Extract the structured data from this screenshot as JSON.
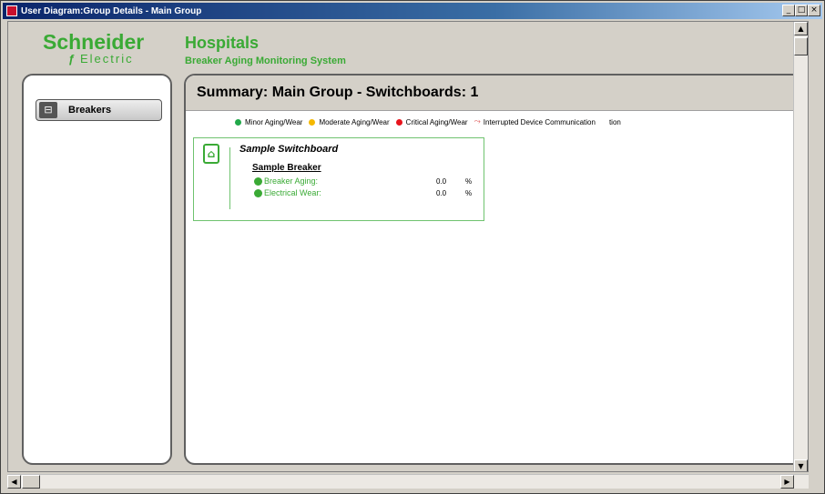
{
  "window": {
    "title": "User Diagram:Group Details - Main Group",
    "minimize_label": "_",
    "maximize_label": "□",
    "close_label": "×"
  },
  "header": {
    "brand": "Schneider",
    "brand_sub": "Electric",
    "app_title": "Hospitals",
    "app_subtitle": "Breaker Aging Monitoring System"
  },
  "sidebar": {
    "items": [
      {
        "label": "Breakers",
        "icon": "breaker-icon"
      }
    ]
  },
  "main": {
    "summary_title": "Summary: Main Group - Switchboards: 1",
    "legend": [
      {
        "label": "Minor Aging/Wear",
        "color": "#21a84a"
      },
      {
        "label": "Moderate Aging/Wear",
        "color": "#f5b800"
      },
      {
        "label": "Critical Aging/Wear",
        "color": "#e8141c"
      },
      {
        "label": "Interrupted Device Communication",
        "color": "#e06060"
      }
    ],
    "legend_extra": "tion",
    "switchboard": {
      "name": "Sample Switchboard",
      "breaker": {
        "name": "Sample Breaker",
        "metrics": [
          {
            "label": "Breaker Aging:",
            "value": "0.0",
            "unit": "%"
          },
          {
            "label": "Electrical Wear:",
            "value": "0.0",
            "unit": "%"
          }
        ]
      }
    }
  },
  "colors": {
    "brand_green": "#3aaa35",
    "card_border": "#6fc36f"
  }
}
